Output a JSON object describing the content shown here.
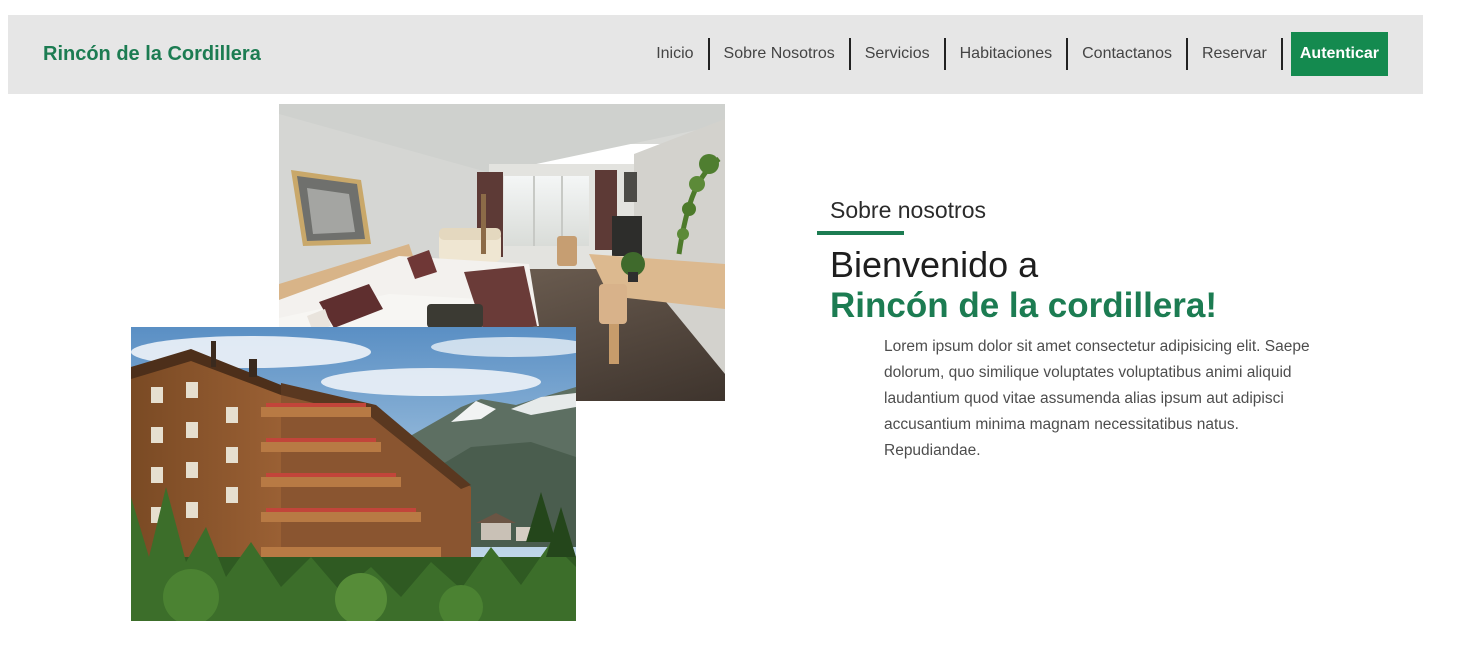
{
  "brand": "Rincón de la Cordillera",
  "nav": {
    "links": [
      "Inicio",
      "Sobre Nosotros",
      "Servicios",
      "Habitaciones",
      "Contactanos",
      "Reservar"
    ],
    "auth_button": "Autenticar"
  },
  "about": {
    "section_label": "Sobre nosotros",
    "welcome": "Bienvenido a",
    "hotel_name": "Rincón de la cordillera!",
    "description": "Lorem ipsum dolor sit amet consectetur adipisicing elit. Saepe dolorum, quo similique voluptates voluptatibus animi aliquid laudantium quod vitae assumenda alias ipsum aut adipisci accusantium minima magnam necessitatibus natus. Repudiandae."
  },
  "colors": {
    "accent": "#1c7c52",
    "button": "#148a4f",
    "navbar_bg": "#e6e6e6"
  }
}
